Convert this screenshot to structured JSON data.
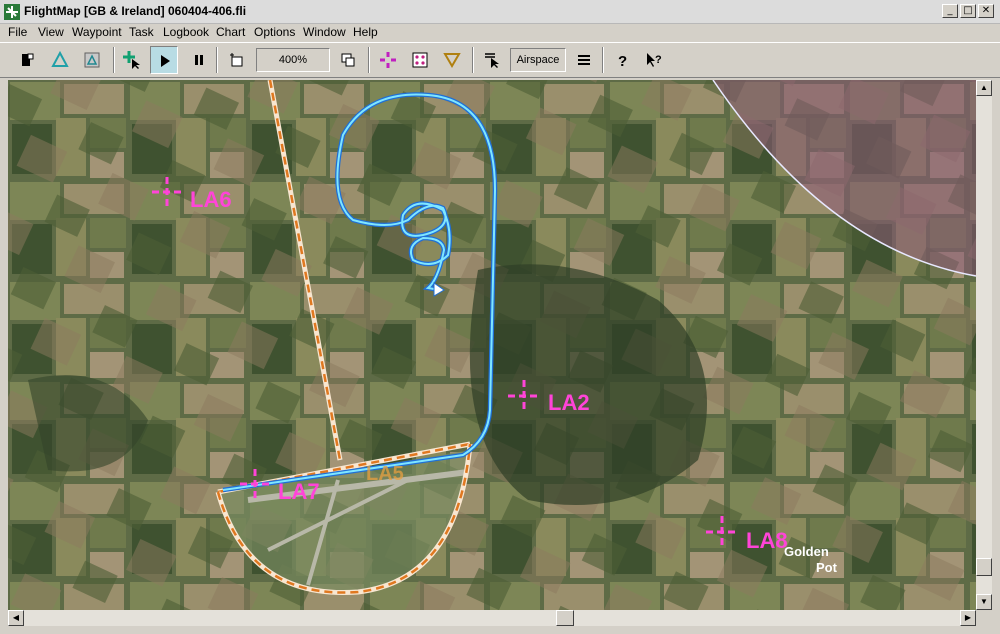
{
  "window": {
    "app_name": "FlightMap",
    "title": "FlightMap  [GB & Ireland]  060404-406.fli",
    "icon": "flightmap-app-icon",
    "controls": [
      "minimize",
      "maximize",
      "close"
    ]
  },
  "menu": [
    "File",
    "View",
    "Waypoint",
    "Task",
    "Logbook",
    "Chart",
    "Options",
    "Window",
    "Help"
  ],
  "toolbar": {
    "buttons": [
      {
        "name": "glider-icon"
      },
      {
        "name": "triangle-task-icon"
      },
      {
        "name": "triangle-box-icon"
      },
      {
        "name": "add-waypoint-cursor-icon"
      },
      {
        "name": "play-icon",
        "pressed": true
      },
      {
        "name": "pause-icon"
      },
      {
        "name": "zoom-region-icon"
      },
      {
        "name": "window-overlap-icon"
      },
      {
        "name": "waypoint-marker-icon"
      },
      {
        "name": "dice-icon"
      },
      {
        "name": "turnpoint-triangle-icon"
      },
      {
        "name": "select-cursor-icon"
      },
      {
        "name": "menu-lines-icon"
      },
      {
        "name": "help-icon"
      },
      {
        "name": "context-help-icon"
      }
    ],
    "zoom_value": "400%",
    "airspace_label": "Airspace"
  },
  "colors": {
    "waypoint": "#ff44d8",
    "track_outer": "#1f6fd6",
    "track_inner": "#7fe6ff",
    "boundary": "#e07820"
  },
  "map": {
    "waypoints": [
      {
        "label": "LA6"
      },
      {
        "label": "LA2"
      },
      {
        "label": "LA7"
      },
      {
        "label": "LA8"
      },
      {
        "label": "LA5"
      }
    ],
    "places": [
      {
        "line1": "Golden",
        "line2": "Pot"
      }
    ]
  },
  "scrollbars": {
    "vertical_position": 0.92,
    "horizontal_position": 0.58
  }
}
